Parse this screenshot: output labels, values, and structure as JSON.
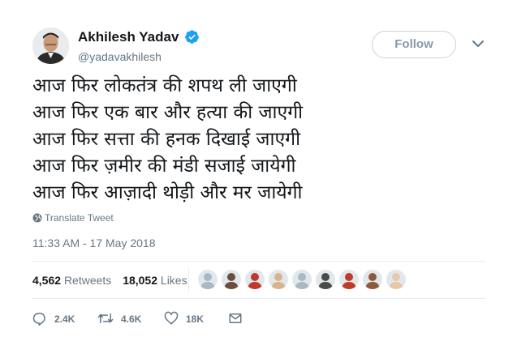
{
  "author": {
    "display_name": "Akhilesh Yadav",
    "handle": "@yadavakhilesh",
    "verified": true
  },
  "follow_button": {
    "label": "Follow"
  },
  "tweet": {
    "lines": [
      "आज फिर लोकतंत्र की शपथ ली जाएगी",
      "आज फिर एक बार और हत्या की जाएगी",
      "आज फिर सत्ता की हनक दिखाई जाएगी",
      "आज फिर ज़मीर की मंडी सजाई जायेगी",
      "आज फिर आज़ादी थोड़ी और मर जायेगी"
    ]
  },
  "translate": {
    "label": "Translate Tweet"
  },
  "timestamp": "11:33 AM - 17 May 2018",
  "stats": {
    "retweets_count": "4,562",
    "retweets_label": "Retweets",
    "likes_count": "18,052",
    "likes_label": "Likes"
  },
  "actions": {
    "reply_count": "2.4K",
    "retweet_count": "4.6K",
    "like_count": "18K"
  },
  "colors": {
    "text_primary": "#14171a",
    "text_secondary": "#657786",
    "verified_blue": "#1da1f2",
    "border": "#e6ecf0",
    "follow_text": "#8899a6"
  },
  "liker_avatars": [
    {
      "name": "liker-1",
      "color": "#aab8c2"
    },
    {
      "name": "liker-2",
      "color": "#6d4c3a"
    },
    {
      "name": "liker-3",
      "color": "#c0392b"
    },
    {
      "name": "liker-4",
      "color": "#d9b38c"
    },
    {
      "name": "liker-5",
      "color": "#aab8c2"
    },
    {
      "name": "liker-6",
      "color": "#4a4a4a"
    },
    {
      "name": "liker-7",
      "color": "#c0392b"
    },
    {
      "name": "liker-8",
      "color": "#8e5a3c"
    },
    {
      "name": "liker-9",
      "color": "#e8c8a8"
    }
  ]
}
